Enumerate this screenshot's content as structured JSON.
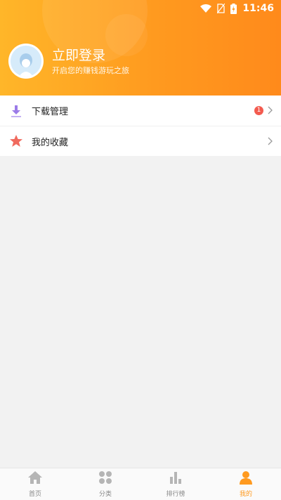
{
  "status_bar": {
    "time": "11:46"
  },
  "header": {
    "title": "立即登录",
    "subtitle": "开启您的赚钱游玩之旅"
  },
  "menu": {
    "items": [
      {
        "label": "下载管理",
        "badge": "1"
      },
      {
        "label": "我的收藏",
        "badge": ""
      }
    ]
  },
  "tabbar": {
    "tabs": [
      {
        "label": "首页",
        "icon": "home-icon",
        "active": false
      },
      {
        "label": "分类",
        "icon": "category-icon",
        "active": false
      },
      {
        "label": "排行榜",
        "icon": "ranking-icon",
        "active": false
      },
      {
        "label": "我的",
        "icon": "profile-icon",
        "active": true
      }
    ]
  },
  "colors": {
    "accent": "#ff9a1f",
    "inactive": "#b5b5b5",
    "badge": "#f35b4f"
  }
}
